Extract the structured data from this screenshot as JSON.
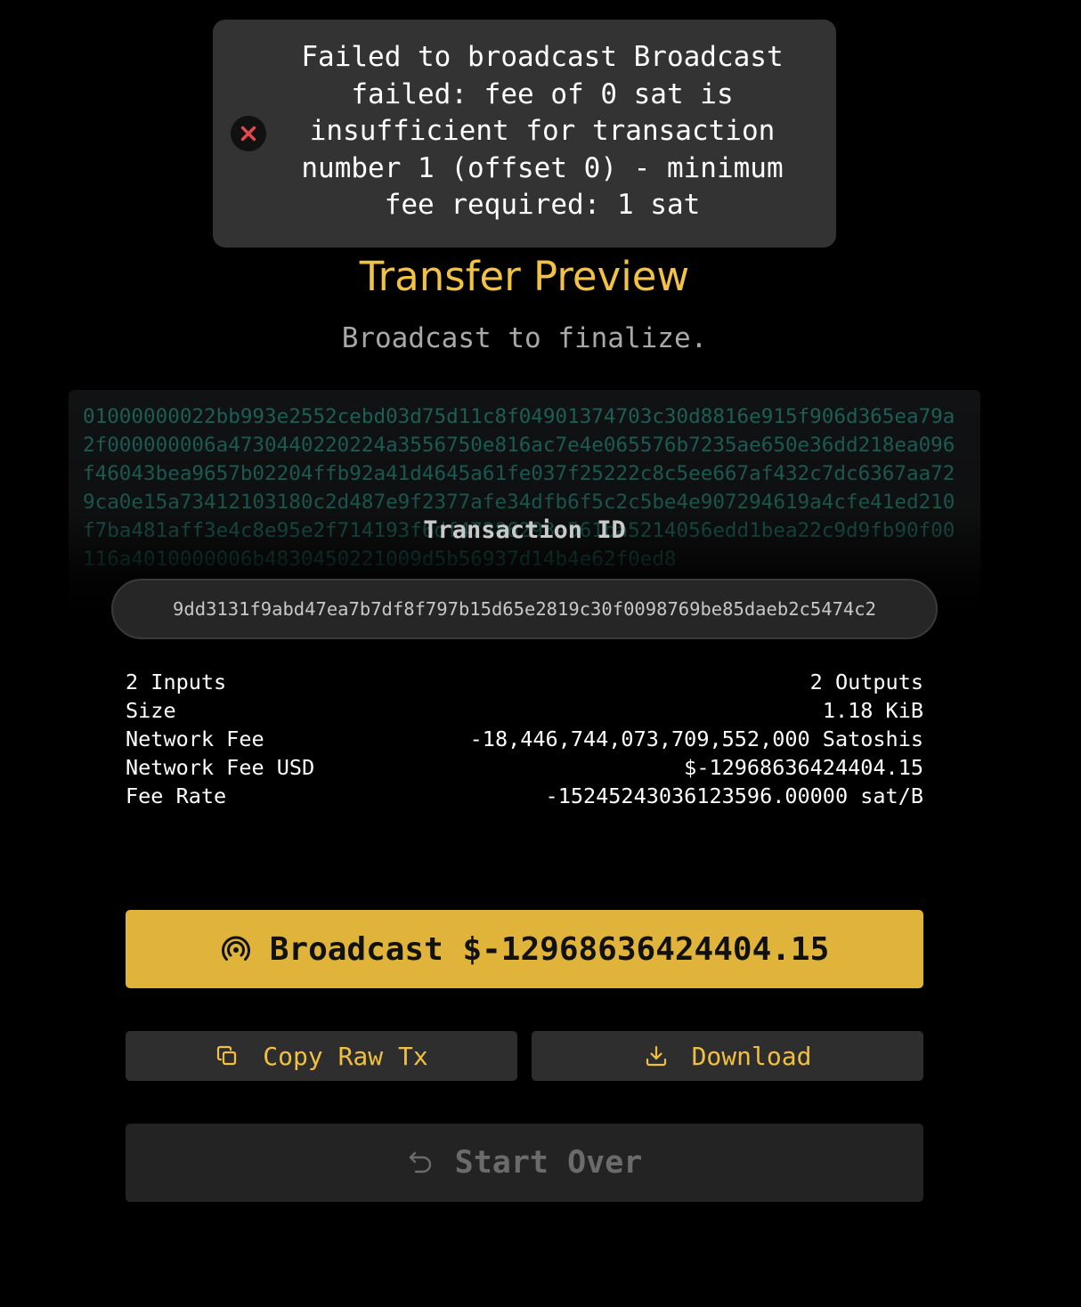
{
  "toast": {
    "message": "Failed to broadcast Broadcast failed: fee of 0 sat is insufficient for transaction number 1 (offset 0) - minimum fee required: 1 sat",
    "icon": "error-x-icon",
    "icon_color": "#e5484d"
  },
  "header": {
    "title": "Transfer Preview",
    "subtitle": "Broadcast to finalize."
  },
  "raw_tx": {
    "hex": "01000000022bb993e2552cebd03d75d11c8f04901374703c30d8816e915f906d365ea79a2f000000006a4730440220224a3556750e816ac7e4e065576b7235ae650e36dd218ea096f46043bea9657b02204ffb92a41d4645a61fe037f25222c8c5ee667af432c7dc6367aa729ca0e15a73412103180c2d487e9f2377afe34dfb6f5c2c5be4e907294619a4cfe41ed210f7ba481aff3e4c8e95e2f714193f6df47286293e561ba5214056edd1bea22c9d9fb90f00116a4010000006b4830450221009d5b56937d14b4e62f0ed8"
  },
  "transaction": {
    "id_label": "Transaction ID",
    "id": "9dd3131f9abd47ea7b7df8f797b15d65e2819c30f0098769be85daeb2c5474c2"
  },
  "details": {
    "inputs": "2 Inputs",
    "outputs": "2 Outputs",
    "size_label": "Size",
    "size_value": "1.18 KiB",
    "fee_label": "Network Fee",
    "fee_value": "-18,446,744,073,709,552,000 Satoshis",
    "fee_usd_label": "Network Fee USD",
    "fee_usd_value": "$-12968636424404.15",
    "fee_rate_label": "Fee Rate",
    "fee_rate_value": "-15245243036123596.00000 sat/B"
  },
  "actions": {
    "broadcast_label": "Broadcast $-12968636424404.15",
    "copy_label": "Copy Raw Tx",
    "download_label": "Download",
    "start_over_label": "Start Over"
  },
  "colors": {
    "accent": "#e0b43a",
    "title": "#f2c244",
    "error": "#e5484d"
  }
}
